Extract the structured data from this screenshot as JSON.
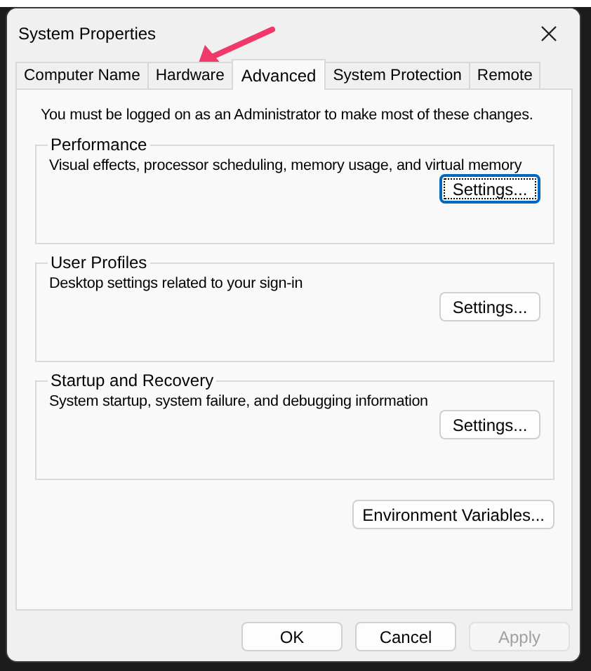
{
  "window": {
    "title": "System Properties"
  },
  "tabs": [
    {
      "label": "Computer Name",
      "selected": false
    },
    {
      "label": "Hardware",
      "selected": false
    },
    {
      "label": "Advanced",
      "selected": true
    },
    {
      "label": "System Protection",
      "selected": false
    },
    {
      "label": "Remote",
      "selected": false
    }
  ],
  "notice": "You must be logged on as an Administrator to make most of these changes.",
  "groups": [
    {
      "title": "Performance",
      "description": "Visual effects, processor scheduling, memory usage, and virtual memory",
      "button": {
        "label": "Settings...",
        "focused": true
      }
    },
    {
      "title": "User Profiles",
      "description": "Desktop settings related to your sign-in",
      "button": {
        "label": "Settings...",
        "focused": false
      }
    },
    {
      "title": "Startup and Recovery",
      "description": "System startup, system failure, and debugging information",
      "button": {
        "label": "Settings...",
        "focused": false
      }
    }
  ],
  "environment_button": {
    "label": "Environment Variables...",
    "focused": false
  },
  "buttons": [
    {
      "label": "OK",
      "disabled": false
    },
    {
      "label": "Cancel",
      "disabled": false
    },
    {
      "label": "Apply",
      "disabled": true
    }
  ]
}
